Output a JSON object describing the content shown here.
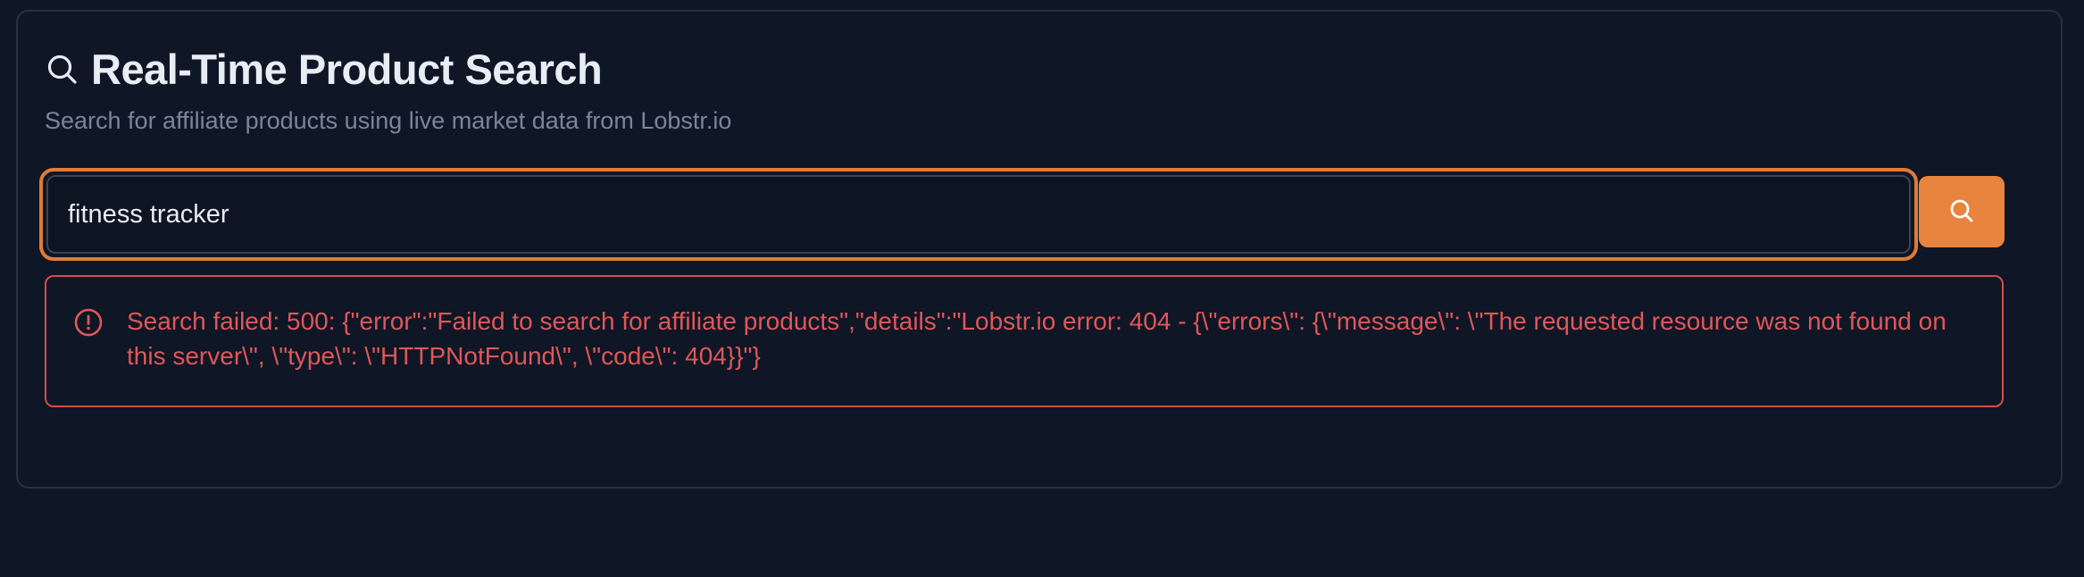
{
  "header": {
    "icon": "search-icon",
    "title": "Real-Time Product Search",
    "subtitle": "Search for affiliate products using live market data from Lobstr.io"
  },
  "search": {
    "value": "fitness tracker",
    "button_icon": "search-icon"
  },
  "error": {
    "icon": "alert-circle-icon",
    "message": "Search failed: 500: {\"error\":\"Failed to search for affiliate products\",\"details\":\"Lobstr.io error: 404 - {\\\"errors\\\": {\\\"message\\\": \\\"The requested resource was not found on this server\\\", \\\"type\\\": \\\"HTTPNotFound\\\", \\\"code\\\": 404}}\"}"
  },
  "colors": {
    "background": "#0f1626",
    "accent": "#e8843e",
    "error": "#e05757",
    "title": "#e8ecf3",
    "subtitle": "#7a8597"
  }
}
